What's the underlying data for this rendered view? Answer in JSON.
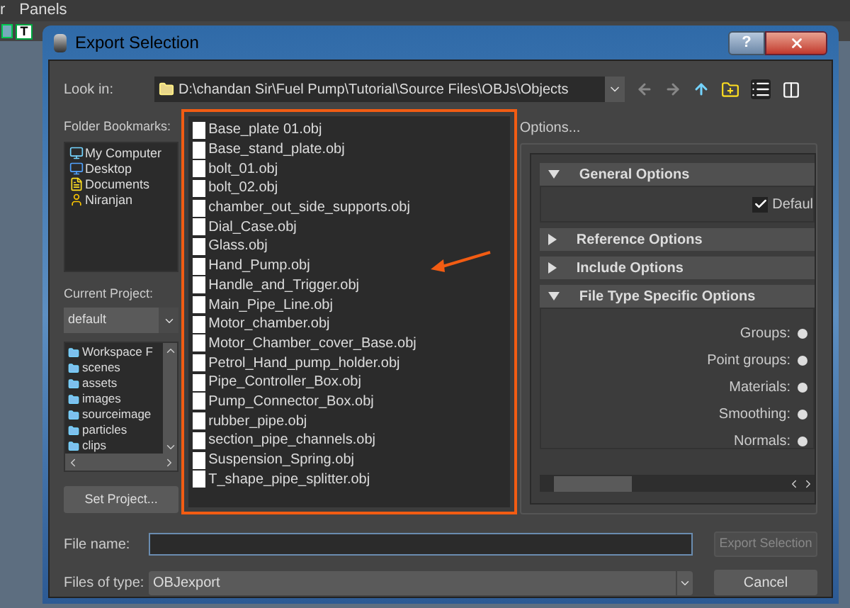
{
  "background_app": {
    "menu": [
      "r",
      "Panels"
    ],
    "toolbar_glyph": "T"
  },
  "dialog": {
    "title": "Export Selection",
    "help": "?",
    "look_in": {
      "label": "Look in:",
      "path": "D:\\chandan Sir\\Fuel Pump\\Tutorial\\Source Files\\OBJs\\Objects"
    },
    "bookmarks": {
      "label": "Folder Bookmarks:",
      "items": [
        {
          "name": "My Computer",
          "kind": "computer"
        },
        {
          "name": "Desktop",
          "kind": "desktop"
        },
        {
          "name": "Documents",
          "kind": "documents"
        },
        {
          "name": "Niranjan",
          "kind": "user"
        }
      ]
    },
    "current_project": {
      "label": "Current Project:",
      "value": "default"
    },
    "project_folders": [
      "Workspace F",
      "scenes",
      "assets",
      "images",
      "sourceimage",
      "particles",
      "clips"
    ],
    "set_project_button": "Set Project...",
    "files": [
      "Base_plate 01.obj",
      "Base_stand_plate.obj",
      "bolt_01.obj",
      "bolt_02.obj",
      "chamber_out_side_supports.obj",
      "Dial_Case.obj",
      "Glass.obj",
      "Hand_Pump.obj",
      "Handle_and_Trigger.obj",
      "Main_Pipe_Line.obj",
      "Motor_chamber.obj",
      "Motor_Chamber_cover_Base.obj",
      "Petrol_Hand_pump_holder.obj",
      "Pipe_Controller_Box.obj",
      "Pump_Connector_Box.obj",
      "rubber_pipe.obj",
      "section_pipe_channels.obj",
      "Suspension_Spring.obj",
      "T_shape_pipe_splitter.obj"
    ],
    "options": {
      "title": "Options...",
      "sections": [
        {
          "title": "General Options",
          "expanded": true,
          "checkbox": {
            "label": "Defaul",
            "checked": true
          }
        },
        {
          "title": "Reference Options",
          "expanded": false
        },
        {
          "title": "Include Options",
          "expanded": false
        },
        {
          "title": "File Type Specific Options",
          "expanded": true,
          "radios": [
            {
              "label": "Groups:",
              "on": true
            },
            {
              "label": "Point groups:",
              "on": true
            },
            {
              "label": "Materials:",
              "on": true
            },
            {
              "label": "Smoothing:",
              "on": true
            },
            {
              "label": "Normals:",
              "on": true
            }
          ]
        }
      ]
    },
    "file_name": {
      "label": "File name:"
    },
    "files_of_type": {
      "label": "Files of type:",
      "value": "OBJexport"
    },
    "buttons": [
      {
        "label": "Export Selection",
        "disabled": true
      },
      {
        "label": "Cancel",
        "disabled": false
      }
    ]
  }
}
